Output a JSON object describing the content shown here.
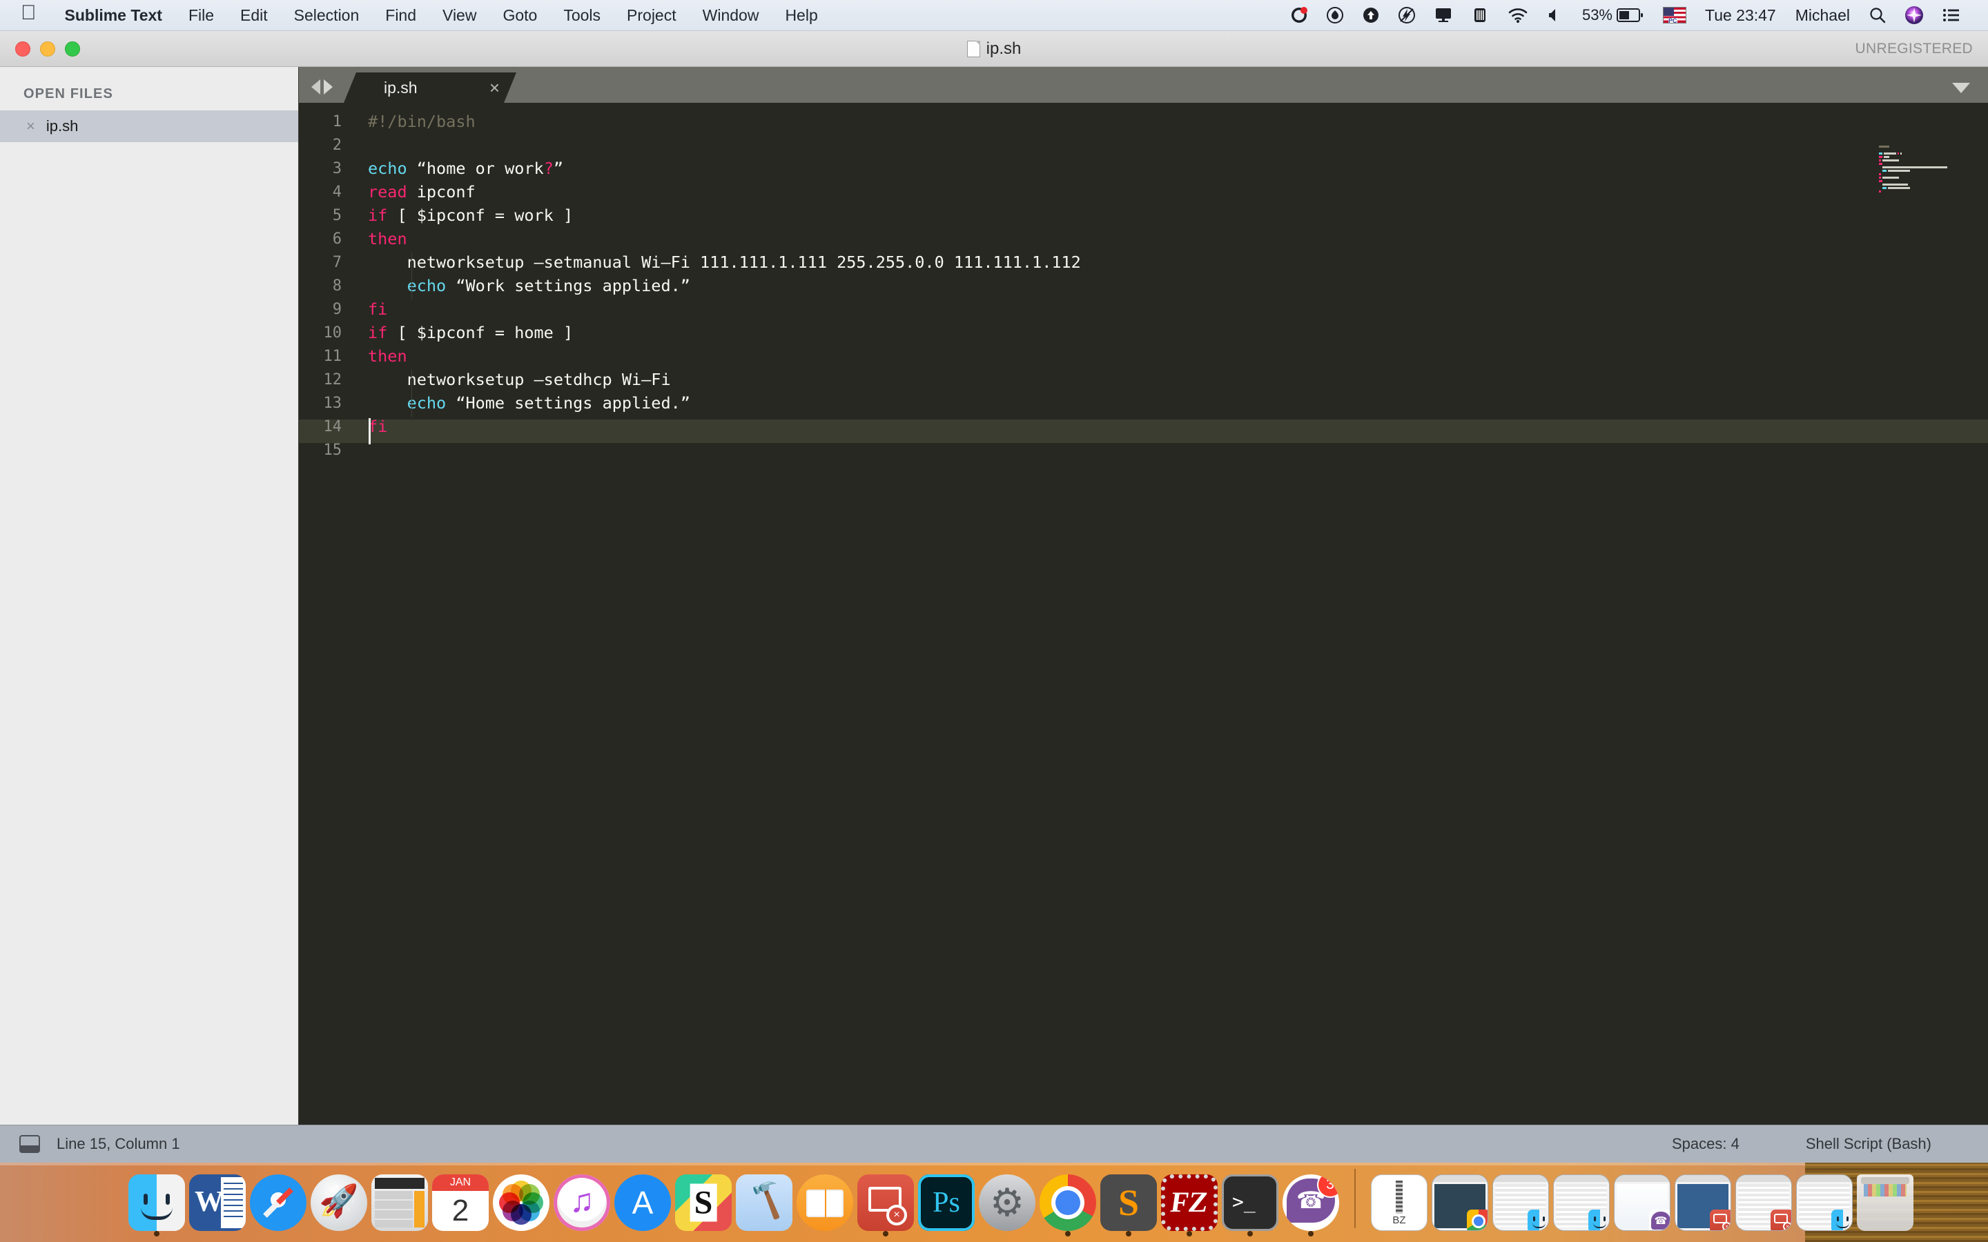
{
  "menubar": {
    "apple_icon": "apple-icon",
    "app_name": "Sublime Text",
    "items": [
      "File",
      "Edit",
      "Selection",
      "Find",
      "View",
      "Goto",
      "Tools",
      "Project",
      "Window",
      "Help"
    ],
    "status_icons": [
      "shazam-icon",
      "dropbox-icon",
      "cloud-upload-icon",
      "flash-icon",
      "airplay-icon",
      "time-machine-icon",
      "wifi-icon",
      "volume-icon"
    ],
    "battery_percent": "53%",
    "input_source": "us-flag-icon",
    "clock": "Tue 23:47",
    "user": "Michael",
    "search_icon": "search-icon",
    "siri_icon": "siri-icon",
    "notification_icon": "notification-center-icon"
  },
  "window": {
    "title": "ip.sh",
    "doc_icon": "document-icon",
    "unregistered": "UNREGISTERED",
    "traffic_lights": [
      "close-button",
      "minimize-button",
      "zoom-button"
    ]
  },
  "sidebar": {
    "header": "OPEN FILES",
    "files": [
      {
        "name": "ip.sh",
        "close": "×"
      }
    ]
  },
  "tabbar": {
    "nav_prev": "prev-tab-arrow",
    "nav_next": "next-tab-arrow",
    "tabs": [
      {
        "label": "ip.sh",
        "close": "×",
        "active": true
      }
    ],
    "menu_caret": "tab-overflow-caret"
  },
  "editor": {
    "line_numbers": [
      "1",
      "2",
      "3",
      "4",
      "5",
      "6",
      "7",
      "8",
      "9",
      "10",
      "11",
      "12",
      "13",
      "14",
      "15"
    ],
    "lines": [
      {
        "n": 1,
        "tokens": [
          {
            "t": "#!/bin/bash",
            "c": "cm"
          }
        ]
      },
      {
        "n": 2,
        "tokens": []
      },
      {
        "n": 3,
        "tokens": [
          {
            "t": "echo ",
            "c": "fn"
          },
          {
            "t": "“home or work",
            "c": "plain"
          },
          {
            "t": "?",
            "c": "kw"
          },
          {
            "t": "”",
            "c": "plain"
          }
        ]
      },
      {
        "n": 4,
        "tokens": [
          {
            "t": "read ",
            "c": "kw"
          },
          {
            "t": "ipconf",
            "c": "plain"
          }
        ]
      },
      {
        "n": 5,
        "tokens": [
          {
            "t": "if ",
            "c": "kw"
          },
          {
            "t": "[ $ipconf = work ]",
            "c": "plain"
          }
        ]
      },
      {
        "n": 6,
        "tokens": [
          {
            "t": "then",
            "c": "kw"
          }
        ]
      },
      {
        "n": 7,
        "tokens": [
          {
            "t": "    networksetup –setmanual Wi–Fi 111.111.1.111 255.255.0.0 111.111.1.112",
            "c": "plain"
          }
        ]
      },
      {
        "n": 8,
        "tokens": [
          {
            "t": "    ",
            "c": "plain"
          },
          {
            "t": "echo ",
            "c": "fn"
          },
          {
            "t": "“Work settings applied.”",
            "c": "plain"
          }
        ]
      },
      {
        "n": 9,
        "tokens": [
          {
            "t": "fi",
            "c": "kw"
          }
        ]
      },
      {
        "n": 10,
        "tokens": [
          {
            "t": "if ",
            "c": "kw"
          },
          {
            "t": "[ $ipconf = home ]",
            "c": "plain"
          }
        ]
      },
      {
        "n": 11,
        "tokens": [
          {
            "t": "then",
            "c": "kw"
          }
        ]
      },
      {
        "n": 12,
        "tokens": [
          {
            "t": "    networksetup –setdhcp Wi–Fi",
            "c": "plain"
          }
        ]
      },
      {
        "n": 13,
        "tokens": [
          {
            "t": "    ",
            "c": "plain"
          },
          {
            "t": "echo ",
            "c": "fn"
          },
          {
            "t": "“Home settings applied.”",
            "c": "plain"
          }
        ]
      },
      {
        "n": 14,
        "tokens": [
          {
            "t": "fi",
            "c": "kw"
          }
        ]
      },
      {
        "n": 15,
        "tokens": []
      }
    ],
    "colors": {
      "background": "#272822",
      "current_line": "#3c3d31",
      "gutter_text": "#8f908a",
      "comment": "#75715e",
      "keyword": "#f92672",
      "function": "#66d9ef",
      "plain_text": "#f8f8f2",
      "caret": "#f8f8f0"
    },
    "minimap": "minimap-panel"
  },
  "statusbar": {
    "encoding_icon": "console-toggle-icon",
    "cursor_position": "Line 15, Column 1",
    "indentation": "Spaces: 4",
    "syntax": "Shell Script (Bash)"
  },
  "dock": {
    "apps": [
      {
        "name": "Finder",
        "icon": "finder-icon",
        "running": true,
        "badge": null
      },
      {
        "name": "Microsoft Word",
        "icon": "word-icon",
        "running": false,
        "badge": null
      },
      {
        "name": "Safari",
        "icon": "safari-icon",
        "running": false,
        "badge": null
      },
      {
        "name": "Launchpad",
        "icon": "launchpad-icon",
        "running": false,
        "badge": null
      },
      {
        "name": "Calculator",
        "icon": "calculator-icon",
        "running": false,
        "badge": null
      },
      {
        "name": "Calendar",
        "icon": "calendar-icon",
        "running": false,
        "badge": null,
        "month": "JAN",
        "day": "2"
      },
      {
        "name": "Photos",
        "icon": "photos-icon",
        "running": false,
        "badge": null
      },
      {
        "name": "iTunes",
        "icon": "itunes-icon",
        "running": false,
        "badge": null
      },
      {
        "name": "App Store",
        "icon": "app-store-icon",
        "running": false,
        "badge": null
      },
      {
        "name": "Sublime Merge",
        "icon": "sublime-merge-icon",
        "running": false,
        "badge": null
      },
      {
        "name": "Xcode",
        "icon": "xcode-icon",
        "running": false,
        "badge": null
      },
      {
        "name": "iBooks",
        "icon": "ibooks-icon",
        "running": false,
        "badge": null
      },
      {
        "name": "Microsoft Remote Desktop",
        "icon": "remote-desktop-icon",
        "running": true,
        "badge": null
      },
      {
        "name": "Photoshop",
        "icon": "photoshop-icon",
        "running": false,
        "badge": null
      },
      {
        "name": "System Preferences",
        "icon": "system-preferences-icon",
        "running": false,
        "badge": null
      },
      {
        "name": "Google Chrome",
        "icon": "chrome-icon",
        "running": true,
        "badge": null
      },
      {
        "name": "Sublime Text",
        "icon": "sublime-text-icon",
        "running": true,
        "badge": null
      },
      {
        "name": "FileZilla",
        "icon": "filezilla-icon",
        "running": true,
        "badge": null
      },
      {
        "name": "Terminal",
        "icon": "terminal-icon",
        "running": true,
        "badge": null
      },
      {
        "name": "Viber",
        "icon": "viber-icon",
        "running": true,
        "badge": "3"
      }
    ],
    "minimized": [
      {
        "name": "BZ archive",
        "icon": "zip-file-icon",
        "label": "BZ"
      },
      {
        "name": "Chrome window",
        "icon": "minimized-window-chrome"
      },
      {
        "name": "Finder window",
        "icon": "minimized-window-finder"
      },
      {
        "name": "Spreadsheet window",
        "icon": "minimized-window-finder-2"
      },
      {
        "name": "Viber window",
        "icon": "minimized-window-viber"
      },
      {
        "name": "Remote desktop window",
        "icon": "minimized-window-rdp"
      },
      {
        "name": "Remote desktop window 2",
        "icon": "minimized-window-rdp-2"
      },
      {
        "name": "Finder window 2",
        "icon": "minimized-window-finder-3"
      }
    ],
    "trash": {
      "name": "Trash",
      "icon": "trash-full-icon"
    }
  }
}
